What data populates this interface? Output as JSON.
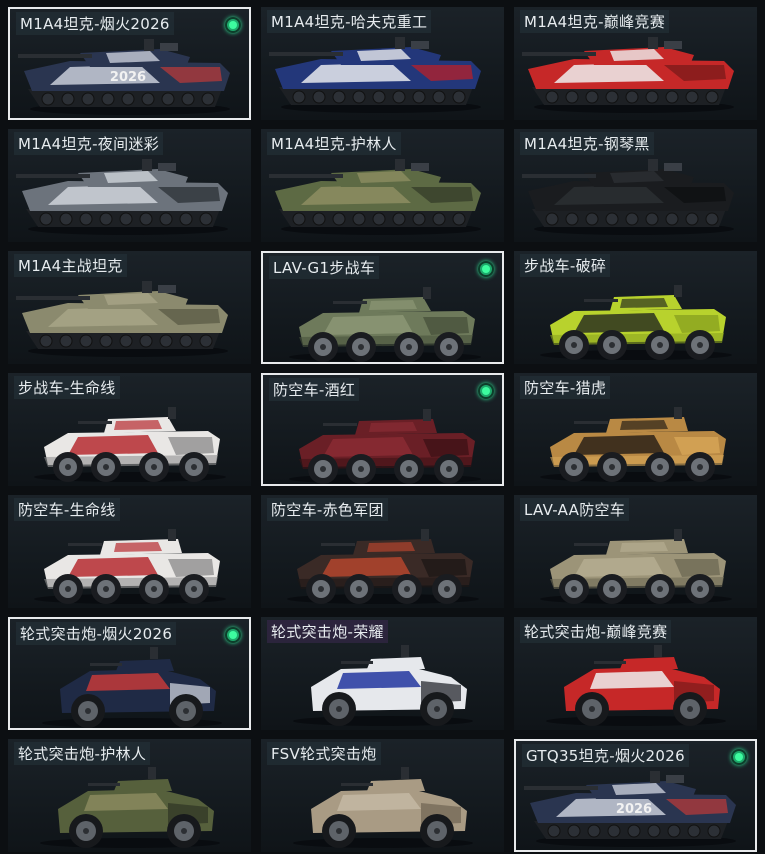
{
  "skins": [
    {
      "name": "M1A4坦克-烟火2026",
      "kind": "tank",
      "colors": [
        "#2a3550",
        "#c8cdd8",
        "#b53a3a"
      ],
      "decal": "2026",
      "selected": true,
      "equipped": true
    },
    {
      "name": "M1A4坦克-哈夫克重工",
      "kind": "tank",
      "colors": [
        "#23377a",
        "#e8eaee",
        "#b8202a"
      ],
      "decal": "",
      "selected": false,
      "equipped": false
    },
    {
      "name": "M1A4坦克-巅峰竞赛",
      "kind": "tank",
      "colors": [
        "#c62828",
        "#efefef",
        "#7a1a1a"
      ],
      "decal": "",
      "selected": false,
      "equipped": false
    },
    {
      "name": "M1A4坦克-夜间迷彩",
      "kind": "tank",
      "colors": [
        "#6c737c",
        "#cfd4da",
        "#2b3036"
      ],
      "decal": "",
      "selected": false,
      "equipped": false
    },
    {
      "name": "M1A4坦克-护林人",
      "kind": "tank",
      "colors": [
        "#5d6a44",
        "#8d8d62",
        "#343c28"
      ],
      "decal": "",
      "selected": false,
      "equipped": false
    },
    {
      "name": "M1A4坦克-钢琴黑",
      "kind": "tank",
      "colors": [
        "#1a1c1f",
        "#2c2f33",
        "#0e0f11"
      ],
      "decal": "",
      "selected": false,
      "equipped": false
    },
    {
      "name": "M1A4主战坦克",
      "kind": "tank",
      "colors": [
        "#8b8a6e",
        "#a7a487",
        "#5a5a45"
      ],
      "decal": "",
      "selected": false,
      "equipped": false
    },
    {
      "name": "LAV-G1步战车",
      "kind": "ifv",
      "colors": [
        "#6e7a5b",
        "#8c9775",
        "#48523c"
      ],
      "decal": "",
      "selected": true,
      "equipped": true
    },
    {
      "name": "步战车-破碎",
      "kind": "ifv",
      "colors": [
        "#b8d22d",
        "#2c3320",
        "#8aa31f"
      ],
      "decal": "",
      "selected": false,
      "equipped": false
    },
    {
      "name": "步战车-生命线",
      "kind": "ifv",
      "colors": [
        "#e9e7e5",
        "#b62b31",
        "#8f8f8f"
      ],
      "decal": "",
      "selected": false,
      "equipped": false
    },
    {
      "name": "防空车-酒红",
      "kind": "aa",
      "colors": [
        "#6a1f26",
        "#8a2c34",
        "#3f1216"
      ],
      "decal": "",
      "selected": true,
      "equipped": true
    },
    {
      "name": "防空车-猎虎",
      "kind": "aa",
      "colors": [
        "#b98944",
        "#2b2218",
        "#d7a658"
      ],
      "decal": "",
      "selected": false,
      "equipped": false
    },
    {
      "name": "防空车-生命线",
      "kind": "aa",
      "colors": [
        "#e9e7e5",
        "#b62b31",
        "#8f8f8f"
      ],
      "decal": "",
      "selected": false,
      "equipped": false
    },
    {
      "name": "防空车-赤色军团",
      "kind": "aa",
      "colors": [
        "#3a2a26",
        "#b4452e",
        "#1e1816"
      ],
      "decal": "",
      "selected": false,
      "equipped": false
    },
    {
      "name": "LAV-AA防空车",
      "kind": "aa",
      "colors": [
        "#9c9478",
        "#b5ad90",
        "#6f6a55"
      ],
      "decal": "",
      "selected": false,
      "equipped": false
    },
    {
      "name": "轮式突击炮-烟火2026",
      "kind": "wheel",
      "colors": [
        "#1f2a45",
        "#c43a3a",
        "#d8dde6"
      ],
      "decal": "",
      "selected": true,
      "equipped": true
    },
    {
      "name": "轮式突击炮-荣耀",
      "kind": "wheel",
      "colors": [
        "#e6e8ec",
        "#2236a0",
        "#1a1d24"
      ],
      "decal": "",
      "selected": false,
      "equipped": false,
      "purple": true
    },
    {
      "name": "轮式突击炮-巅峰竞赛",
      "kind": "wheel",
      "colors": [
        "#c62828",
        "#efefef",
        "#7a1a1a"
      ],
      "decal": "",
      "selected": false,
      "equipped": false
    },
    {
      "name": "轮式突击炮-护林人",
      "kind": "wheel",
      "colors": [
        "#56603c",
        "#8a8a5e",
        "#2f3523"
      ],
      "decal": "",
      "selected": false,
      "equipped": false
    },
    {
      "name": "FSV轮式突击炮",
      "kind": "wheel",
      "colors": [
        "#a99b84",
        "#c4b9a3",
        "#6f6453"
      ],
      "decal": "",
      "selected": false,
      "equipped": false
    },
    {
      "name": "GTQ35坦克-烟火2026",
      "kind": "tank",
      "colors": [
        "#2a3550",
        "#c8cdd8",
        "#b53a3a"
      ],
      "decal": "2026",
      "selected": true,
      "equipped": true
    }
  ]
}
